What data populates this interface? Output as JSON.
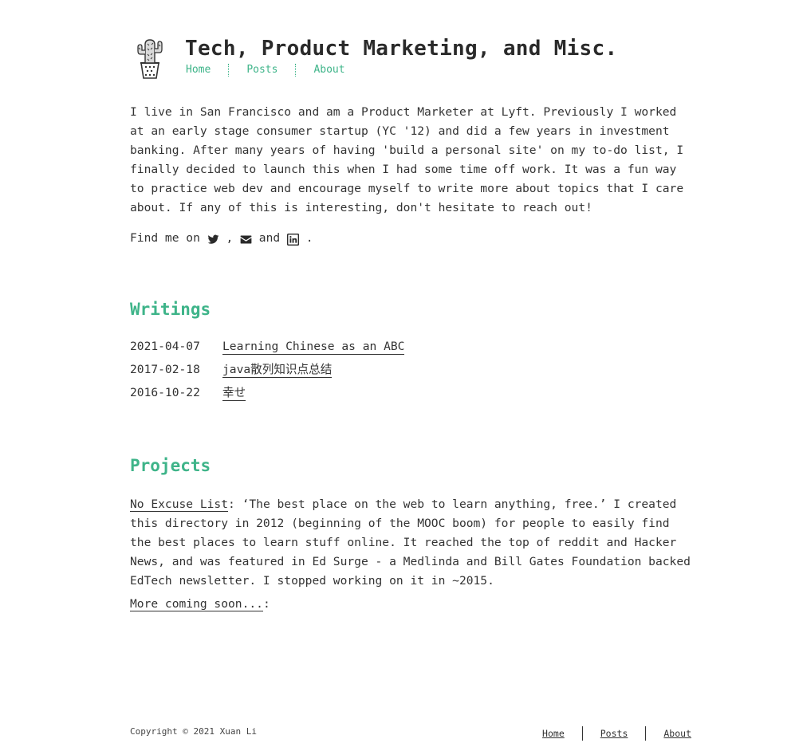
{
  "header": {
    "logo_icon": "cactus-icon",
    "title": "Tech, Product Marketing, and Misc.",
    "nav": [
      {
        "label": "Home"
      },
      {
        "label": "Posts"
      },
      {
        "label": "About"
      }
    ]
  },
  "intro": {
    "text": "I live in San Francisco and am a Product Marketer at Lyft. Previously I worked at an early stage consumer startup (YC '12) and did a few years in investment banking. After many years of having 'build a personal site' on my to-do list, I finally decided to launch this when I had some time off work. It was a fun way to practice web dev and encourage myself to write more about topics that I care about. If any of this is interesting, don't hesitate to reach out!",
    "find_me_prefix": "Find me on ",
    "find_me_sep": " , ",
    "find_me_and": " and ",
    "find_me_end": " .",
    "icons": [
      "twitter-icon",
      "email-icon",
      "linkedin-icon"
    ]
  },
  "writings": {
    "title": "Writings",
    "posts": [
      {
        "date": "2021-04-07",
        "title": "Learning Chinese as an ABC"
      },
      {
        "date": "2017-02-18",
        "title": "java散列知识点总结"
      },
      {
        "date": "2016-10-22",
        "title": "幸せ"
      }
    ]
  },
  "projects": {
    "title": "Projects",
    "item_link": "No Excuse List",
    "item_text": ": ‘The best place on the web to learn anything, free.’ I created this directory in 2012 (beginning of the MOOC boom) for people to easily find the best places to learn stuff online. It reached the top of reddit and Hacker News, and was featured in Ed Surge - a Medlinda and Bill Gates Foundation backed EdTech newsletter. I stopped working on it in ~2015.",
    "more_link": "More coming soon...",
    "more_suffix": ":"
  },
  "footer": {
    "copyright": "Copyright © 2021 Xuan Li",
    "nav": [
      {
        "label": "Home"
      },
      {
        "label": "Posts"
      },
      {
        "label": "About"
      }
    ]
  },
  "colors": {
    "accent": "#3eb489",
    "text": "#333333",
    "background": "#ffffff"
  }
}
